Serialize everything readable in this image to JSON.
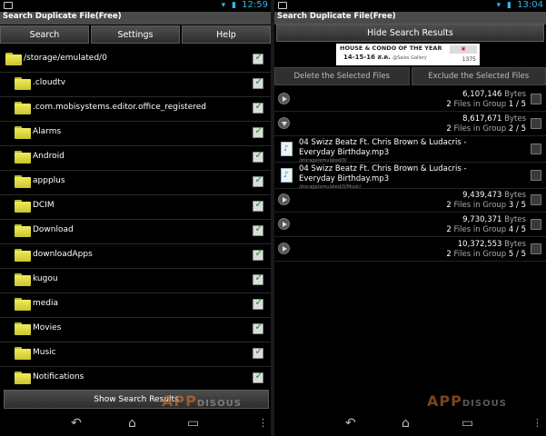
{
  "left": {
    "status_time": "12:59",
    "title": "Search Duplicate File(Free)",
    "tabs": [
      "Search",
      "Settings",
      "Help"
    ],
    "root_path": "/storage/emulated/0",
    "folders": [
      ".cloudtv",
      ".com.mobisystems.editor.office_registered",
      "Alarms",
      "Android",
      "appplus",
      "DCIM",
      "Download",
      "downloadApps",
      "kugou",
      "media",
      "Movies",
      "Music",
      "Notifications"
    ],
    "show_button": "Show Search Results"
  },
  "right": {
    "status_time": "13:04",
    "title": "Search Duplicate File(Free)",
    "hide_button": "Hide Search Results",
    "ad": {
      "line1": "HOUSE & CONDO OF THE YEAR",
      "line2": "14-15-16 ส.ค.",
      "line2b": "@Sales Gallery",
      "phone": "1375"
    },
    "delete_button": "Delete the Selected Files",
    "exclude_button": "Exclude the Selected Files",
    "bytes_unit": "Bytes",
    "groups": [
      {
        "bytes": "6,107,146",
        "count": "2",
        "group": "1 / 5"
      },
      {
        "bytes": "8,617,671",
        "count": "2",
        "group": "2 / 5",
        "expanded": true,
        "files": [
          {
            "name": "04 Swizz Beatz Ft. Chris Brown & Ludacris - Everyday Birthday.mp3",
            "path": "/storage/emulated/0/"
          },
          {
            "name": "04 Swizz Beatz Ft. Chris Brown & Ludacris - Everyday Birthday.mp3",
            "path": "/storage/emulated/0/Music/"
          }
        ]
      },
      {
        "bytes": "9,439,473",
        "count": "2",
        "group": "3 / 5"
      },
      {
        "bytes": "9,730,371",
        "count": "2",
        "group": "4 / 5"
      },
      {
        "bytes": "10,372,553",
        "count": "2",
        "group": "5 / 5"
      }
    ],
    "files_in_group_label": "Files in Group"
  },
  "watermark": {
    "main": "APP",
    "sub": "DISOUS"
  },
  "colors": {
    "accent": "#33b5e5",
    "folder": "#e8e44a",
    "check": "#2a8a2a"
  }
}
